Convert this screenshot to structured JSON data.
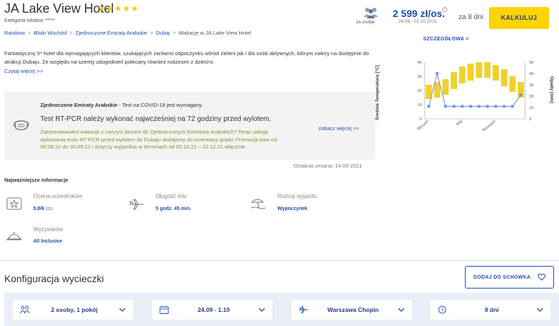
{
  "header": {
    "hotel_name": "JA Lake View Hotel",
    "stars": "★★★★★",
    "category": "Kategoria lokalna: *****",
    "breadcrumb": [
      {
        "label": "Rainbow"
      },
      {
        "label": "Bliski Wschód"
      },
      {
        "label": "Zjednoczone Emiraty Arabskie"
      },
      {
        "label": "Dubaj"
      },
      {
        "label": "Wakacje w JA Lake View Hotel"
      }
    ],
    "breadcrumb_sep": ">"
  },
  "pricing": {
    "per_person_label": "za osobę",
    "price": "2 599 zł/os.",
    "info_glyph": "i",
    "dates": "24.09 - 01.10.2021",
    "nights": "za 8 dni",
    "calculate_label": "KALKULUJ"
  },
  "details_link": "SZCZEGÓŁOWA >",
  "description": {
    "text": "Fantastyczny 5* hotel dla wymagających klientów, szukających zarówno odpoczynku wśród zieleni jak i dla osób aktywnych, którym zależy na dostępnie do atrakcji Dubaju. Ze względu na szereg udogodnień polecany również rodzinom z dziećmi.",
    "read_more": "Czytaj więcej >>"
  },
  "covid": {
    "country": "Zjednoczone Emiraty Arabskie",
    "head_rest": " - Test na COVID-19 jest wymagany.",
    "rule": "Test RT-PCR należy wykonać najwcześniej na 72 godziny przed wylotem.",
    "promo": "Zarezerwowałeś wakacje z naszym biurem do Zjednoczonych Emiratów Arabskich? Teraz usługę wykonania testu RT-PCR przed wylotem do Dubaju dodajemy do rezerwacji gratis! Promocja trwa od 06.08.21 do 30.09.21 i dotyczy wyjazdów w terminach od 05.10.21 – 22.12.21 włącznie.",
    "see_more": "zobacz więcej >>",
    "last_change": "Ostatnia zmiana: 14-09-2021"
  },
  "info": {
    "heading": "Najważniejsze informacje",
    "rating_label": "Ocena uczestników",
    "rating_value": "5.8/6",
    "rating_count": "(12)",
    "flight_label": "Długość lotu",
    "flight_value": "5 godz. 45 min.",
    "trip_label": "Rodzaj wyjazdu",
    "trip_value": "Wypoczynek",
    "board_label": "Wyżywienie",
    "board_value": "All Inclusive"
  },
  "chart_data": {
    "type": "bar",
    "ylabel": "Średnia Temperatura [°C]",
    "y2label": "Opady [mm]",
    "ylim": [
      0,
      40
    ],
    "y2lim": [
      0,
      50
    ],
    "yticks": [
      "40",
      "30",
      "20",
      "10",
      "0"
    ],
    "y2ticks": [
      "50",
      "40",
      "30",
      "20",
      "10",
      "0"
    ],
    "xticks": [
      {
        "index": 0,
        "label": "Styczeń"
      },
      {
        "index": 4,
        "label": "Maj"
      },
      {
        "index": 8,
        "label": "Wrzesień"
      }
    ],
    "temp_ranges": [
      [
        14,
        24
      ],
      [
        15,
        26
      ],
      [
        17,
        28
      ],
      [
        21,
        33
      ],
      [
        25,
        37
      ],
      [
        27,
        39
      ],
      [
        29,
        40
      ],
      [
        29,
        40
      ],
      [
        27,
        38
      ],
      [
        23,
        35
      ],
      [
        19,
        30
      ],
      [
        15,
        26
      ]
    ],
    "precipitation": [
      11,
      40,
      11,
      11,
      11,
      11,
      11,
      11,
      11,
      11,
      11,
      21
    ],
    "bar_color": "#f0d12a",
    "line_color": "#6f9ae6"
  },
  "config": {
    "title": "Konfiguracja wycieczki",
    "stash_label": "DODAJ DO SCHOWKA",
    "selects": [
      {
        "value": "2 osoby, 1 pokój"
      },
      {
        "value": "24.09 - 1.10"
      },
      {
        "value": "Warszawa Chopin"
      },
      {
        "value": "8 dni"
      }
    ]
  },
  "colors": {
    "accent": "#1f4db3",
    "button_yellow": "#ffd400",
    "promo_green": "#7a9a2a"
  }
}
